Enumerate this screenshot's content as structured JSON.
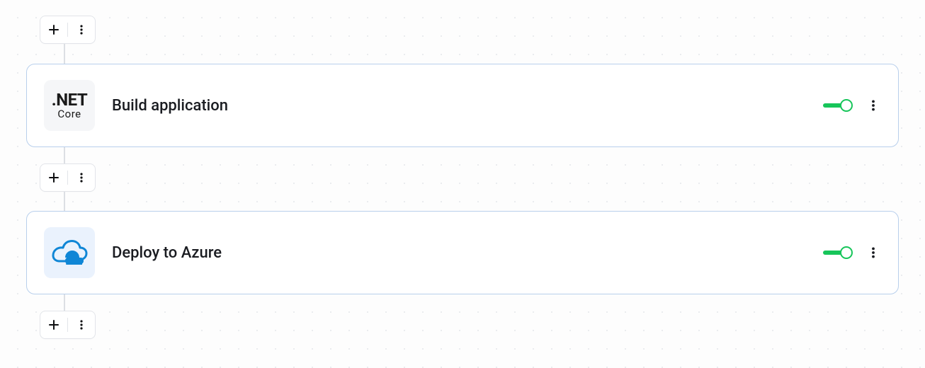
{
  "steps": [
    {
      "icon": "dotnet-core",
      "icon_text_top": ".NET",
      "icon_text_bottom": "Core",
      "title": "Build application",
      "enabled": true
    },
    {
      "icon": "azure-cloud",
      "title": "Deploy to Azure",
      "enabled": true
    }
  ],
  "colors": {
    "toggle_on": "#17c55a",
    "card_border": "#b8cfec",
    "azure_blue": "#0f86d6"
  }
}
